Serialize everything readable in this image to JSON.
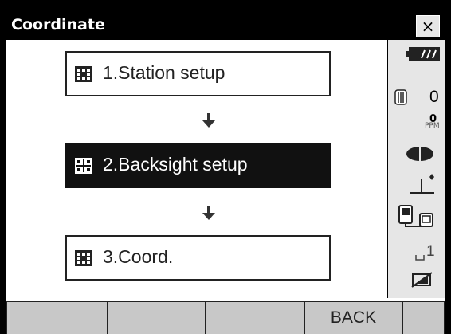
{
  "window": {
    "title": "Coordinate",
    "close_label": "×"
  },
  "steps": [
    {
      "label": "1.Station setup",
      "selected": false
    },
    {
      "label": "2.Backsight setup",
      "selected": true
    },
    {
      "label": "3.Coord.",
      "selected": false
    }
  ],
  "status_panel": {
    "battery_icon": "battery-icon",
    "prism_constant": "0",
    "ppm_value": "0",
    "ppm_unit": "PPM",
    "target_icon": "target-icon",
    "tilt_icon": "tilt-icon",
    "communication_icon": "communication-icon",
    "input_mode": "1",
    "memory_icon": "memory-icon"
  },
  "softkeys": [
    "",
    "",
    "",
    "BACK"
  ],
  "colors": {
    "selected_bg": "#111111",
    "panel_bg": "#e6e6e6",
    "softkey_bg": "#c8c8c8"
  }
}
